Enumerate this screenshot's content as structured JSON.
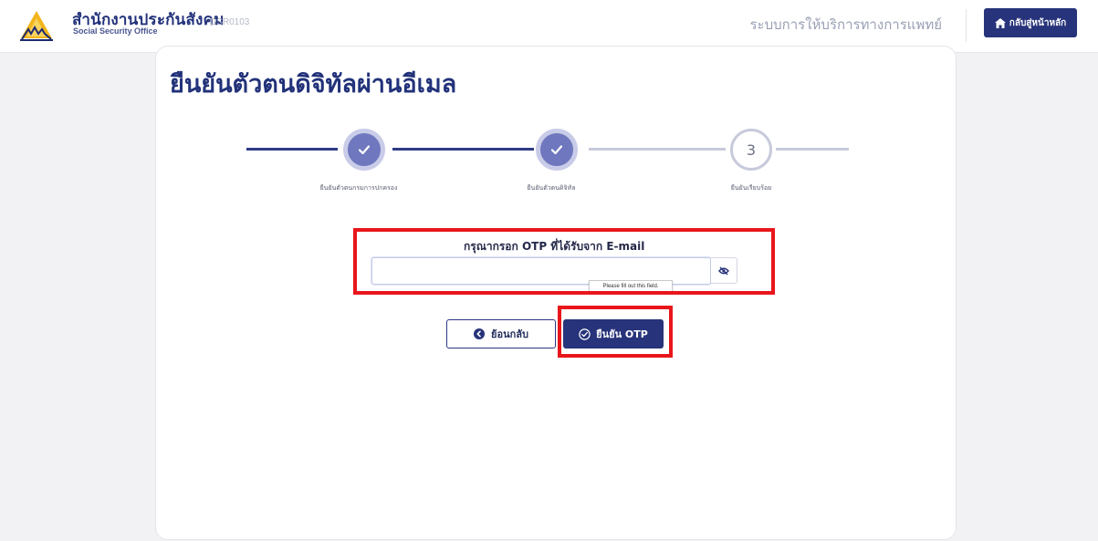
{
  "header": {
    "org_name": "สำนักงานประกันสังคม",
    "org_subtitle": "Social Security Office",
    "page_code": "DSR0103",
    "system_name": "ระบบการให้บริการทางการแพทย์",
    "home_button_label": "กลับสู่หน้าหลัก",
    "home_icon": "home-icon",
    "logo_icon": "sso-logo-icon"
  },
  "main": {
    "title": "ยืนยันตัวตนดิจิทัลผ่านอีเมล",
    "steps": [
      {
        "status": "done",
        "icon": "check-icon",
        "label": "ยืนยันตัวตนกรมการปกครอง"
      },
      {
        "status": "done",
        "icon": "check-icon",
        "label": "ยืนยันตัวตนดิจิทัล"
      },
      {
        "status": "current",
        "number": "3",
        "label": "ยืนยันเรียบร้อย"
      }
    ],
    "otp": {
      "label": "กรุณากรอก OTP ที่ได้รับจาก E-mail",
      "value": "",
      "placeholder": "",
      "toggle_icon": "eye-slash-icon",
      "validation_tooltip": "Please fill out this field."
    },
    "back_button_label": "ย้อนกลับ",
    "back_icon": "chevron-left-circle-icon",
    "confirm_button_label": "ยืนยัน OTP",
    "confirm_icon": "check-circle-icon"
  },
  "colors": {
    "brand_navy": "#27337a",
    "step_done": "#6f78be",
    "step_pending_line": "#c7cadb",
    "highlight_red": "#e8161b",
    "page_bg": "#f2f2f4"
  }
}
